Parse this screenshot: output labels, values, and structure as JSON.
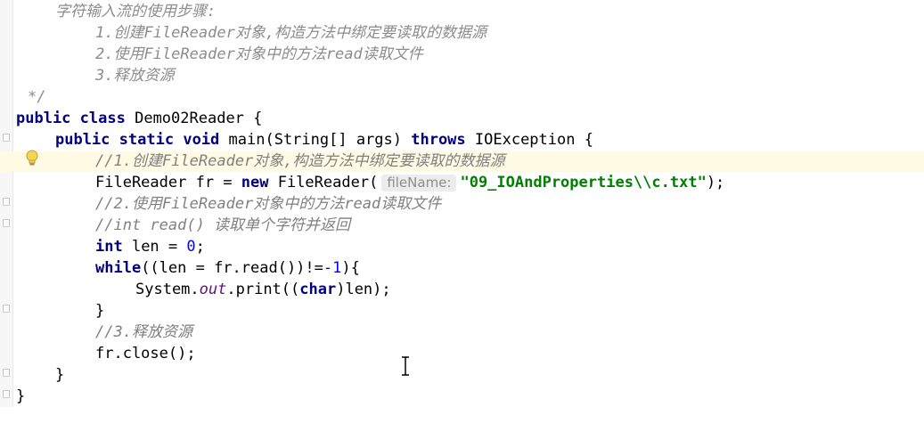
{
  "editor": {
    "doc_lines": [
      "字符输入流的使用步骤:",
      "1.创建FileReader对象,构造方法中绑定要读取的数据源",
      "2.使用FileReader对象中的方法read读取文件",
      "3.释放资源",
      "*/"
    ],
    "class_decl": {
      "kw_public": "public",
      "kw_class": "class",
      "name": " Demo02Reader {"
    },
    "method_decl": {
      "kw_public": "public",
      "kw_static": "static",
      "kw_void": "void",
      "sig": " main(String[] args) ",
      "kw_throws": "throws",
      "exc": " IOException {"
    },
    "comment1": "//1.创建FileReader对象,构造方法中绑定要读取的数据源",
    "reader_line": {
      "pre": "FileReader fr = ",
      "kw_new": "new",
      "ctor": " FileReader(",
      "hint": "fileName:",
      "str": "\"09_IOAndProperties\\\\c.txt\"",
      "post": ");"
    },
    "comment2": "//2.使用FileReader对象中的方法read读取文件",
    "comment3": "//int read() 读取单个字符并返回",
    "len_line": {
      "kw_int": "int",
      "mid": " len = ",
      "num": "0",
      "end": ";"
    },
    "while_line": {
      "kw_while": "while",
      "mid": "((len = fr.read())!=",
      "num": "-1",
      "end": "){"
    },
    "print_line": {
      "pre": "System.",
      "field": "out",
      "mid": ".print((",
      "kw_char": "char",
      "end": ")len);"
    },
    "close_brace_inner": "}",
    "comment4": "//3.释放资源",
    "close_line": "fr.close();",
    "close_brace_method": "}",
    "close_brace_class": "}"
  },
  "colors": {
    "keyword": "#000080",
    "string": "#008000",
    "comment": "#808080",
    "number": "#0000ff",
    "caret_line": "#fffae3"
  },
  "icons": {
    "intention": "lightbulb-icon",
    "mouse": "text-cursor-icon"
  }
}
